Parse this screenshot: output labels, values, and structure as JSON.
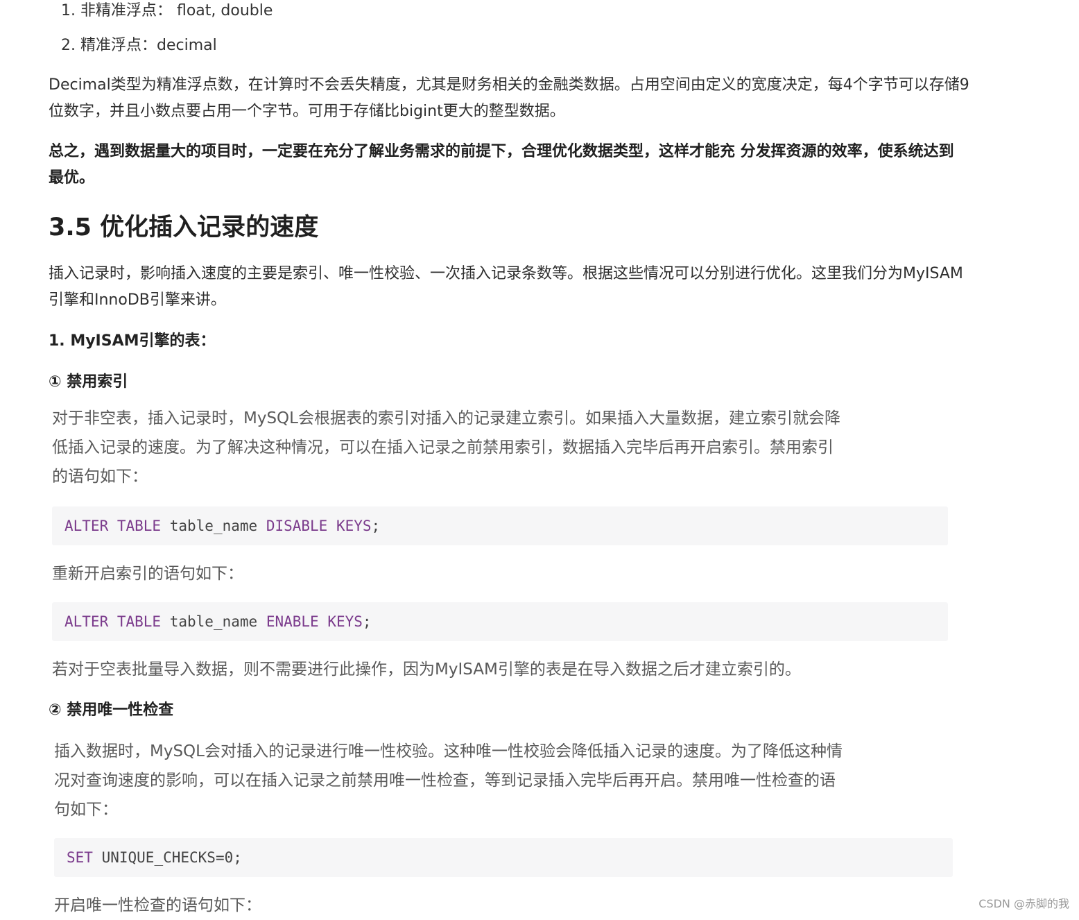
{
  "list": [
    {
      "text": "1. 非精准浮点： float, double"
    },
    {
      "text": "2. 精准浮点：decimal"
    }
  ],
  "decimal_para": {
    "line1": "Decimal类型为精准浮点数，在计算时不会丢失精度，尤其是财务相关的金融类数据。占用空间由定义的宽度决定，每4个字节可以存储9",
    "line2": "位数字，并且小数点要占用一个字节。可用于存储比bigint更大的整型数据。"
  },
  "summary_para": {
    "line1": "总之，遇到数据量大的项目时，一定要在充分了解业务需求的前提下，合理优化数据类型，这样才能充 分发挥资源的效率，使系统达到",
    "line2": "最优。"
  },
  "section_title": "3.5 优化插入记录的速度",
  "intro_para": {
    "line1": "插入记录时，影响插入速度的主要是索引、唯一性校验、一次插入记录条数等。根据这些情况可以分别进行优化。这里我们分为MyISAM",
    "line2": "引擎和InnoDB引擎来讲。"
  },
  "sub_heading_1": "1. MyISAM引擎的表：",
  "step_1_title": "① 禁用索引",
  "disable_index": {
    "text_line1": "对于非空表，插入记录时，MySQL会根据表的索引对插入的记录建立索引。如果插入大量数据，建立索引就会降",
    "text_line2": "低插入记录的速度。为了解决这种情况，可以在插入记录之前禁用索引，数据插入完毕后再开启索引。禁用索引",
    "text_line3": "的语句如下：",
    "code1": {
      "keyword": "ALTER TABLE",
      "name": "table_name",
      "keyword2": "DISABLE KEYS",
      "tail": ";"
    },
    "reenable_label": "重新开启索引的语句如下：",
    "code2": {
      "keyword": "ALTER TABLE",
      "name": "table_name",
      "keyword2": "ENABLE KEYS",
      "tail": ";"
    },
    "note": "若对于空表批量导入数据，则不需要进行此操作，因为MyISAM引擎的表是在导入数据之后才建立索引的。"
  },
  "step_2_title": "② 禁用唯一性检查",
  "disable_unique": {
    "text_line1": "插入数据时，MySQL会对插入的记录进行唯一性校验。这种唯一性校验会降低插入记录的速度。为了降低这种情",
    "text_line2": "况对查询速度的影响，可以在插入记录之前禁用唯一性检查，等到记录插入完毕后再开启。禁用唯一性检查的语",
    "text_line3": "句如下：",
    "code": {
      "keyword": "SET",
      "rest": "UNIQUE_CHECKS=0;"
    },
    "enable_label": "开启唯一性检查的语句如下："
  },
  "watermark": "CSDN @赤脚的我"
}
